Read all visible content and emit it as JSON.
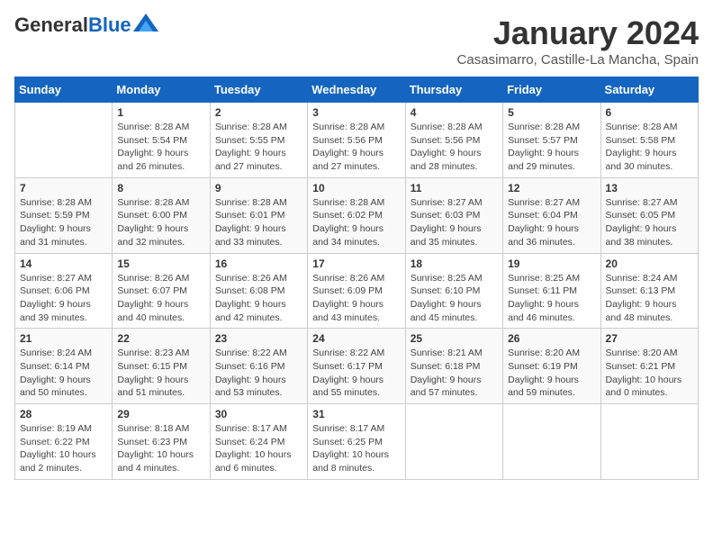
{
  "header": {
    "logo_general": "General",
    "logo_blue": "Blue",
    "month_title": "January 2024",
    "subtitle": "Casasimarro, Castille-La Mancha, Spain"
  },
  "days_of_week": [
    "Sunday",
    "Monday",
    "Tuesday",
    "Wednesday",
    "Thursday",
    "Friday",
    "Saturday"
  ],
  "weeks": [
    [
      {
        "day": "",
        "content": ""
      },
      {
        "day": "1",
        "content": "Sunrise: 8:28 AM\nSunset: 5:54 PM\nDaylight: 9 hours\nand 26 minutes."
      },
      {
        "day": "2",
        "content": "Sunrise: 8:28 AM\nSunset: 5:55 PM\nDaylight: 9 hours\nand 27 minutes."
      },
      {
        "day": "3",
        "content": "Sunrise: 8:28 AM\nSunset: 5:56 PM\nDaylight: 9 hours\nand 27 minutes."
      },
      {
        "day": "4",
        "content": "Sunrise: 8:28 AM\nSunset: 5:56 PM\nDaylight: 9 hours\nand 28 minutes."
      },
      {
        "day": "5",
        "content": "Sunrise: 8:28 AM\nSunset: 5:57 PM\nDaylight: 9 hours\nand 29 minutes."
      },
      {
        "day": "6",
        "content": "Sunrise: 8:28 AM\nSunset: 5:58 PM\nDaylight: 9 hours\nand 30 minutes."
      }
    ],
    [
      {
        "day": "7",
        "content": "Sunrise: 8:28 AM\nSunset: 5:59 PM\nDaylight: 9 hours\nand 31 minutes."
      },
      {
        "day": "8",
        "content": "Sunrise: 8:28 AM\nSunset: 6:00 PM\nDaylight: 9 hours\nand 32 minutes."
      },
      {
        "day": "9",
        "content": "Sunrise: 8:28 AM\nSunset: 6:01 PM\nDaylight: 9 hours\nand 33 minutes."
      },
      {
        "day": "10",
        "content": "Sunrise: 8:28 AM\nSunset: 6:02 PM\nDaylight: 9 hours\nand 34 minutes."
      },
      {
        "day": "11",
        "content": "Sunrise: 8:27 AM\nSunset: 6:03 PM\nDaylight: 9 hours\nand 35 minutes."
      },
      {
        "day": "12",
        "content": "Sunrise: 8:27 AM\nSunset: 6:04 PM\nDaylight: 9 hours\nand 36 minutes."
      },
      {
        "day": "13",
        "content": "Sunrise: 8:27 AM\nSunset: 6:05 PM\nDaylight: 9 hours\nand 38 minutes."
      }
    ],
    [
      {
        "day": "14",
        "content": "Sunrise: 8:27 AM\nSunset: 6:06 PM\nDaylight: 9 hours\nand 39 minutes."
      },
      {
        "day": "15",
        "content": "Sunrise: 8:26 AM\nSunset: 6:07 PM\nDaylight: 9 hours\nand 40 minutes."
      },
      {
        "day": "16",
        "content": "Sunrise: 8:26 AM\nSunset: 6:08 PM\nDaylight: 9 hours\nand 42 minutes."
      },
      {
        "day": "17",
        "content": "Sunrise: 8:26 AM\nSunset: 6:09 PM\nDaylight: 9 hours\nand 43 minutes."
      },
      {
        "day": "18",
        "content": "Sunrise: 8:25 AM\nSunset: 6:10 PM\nDaylight: 9 hours\nand 45 minutes."
      },
      {
        "day": "19",
        "content": "Sunrise: 8:25 AM\nSunset: 6:11 PM\nDaylight: 9 hours\nand 46 minutes."
      },
      {
        "day": "20",
        "content": "Sunrise: 8:24 AM\nSunset: 6:13 PM\nDaylight: 9 hours\nand 48 minutes."
      }
    ],
    [
      {
        "day": "21",
        "content": "Sunrise: 8:24 AM\nSunset: 6:14 PM\nDaylight: 9 hours\nand 50 minutes."
      },
      {
        "day": "22",
        "content": "Sunrise: 8:23 AM\nSunset: 6:15 PM\nDaylight: 9 hours\nand 51 minutes."
      },
      {
        "day": "23",
        "content": "Sunrise: 8:22 AM\nSunset: 6:16 PM\nDaylight: 9 hours\nand 53 minutes."
      },
      {
        "day": "24",
        "content": "Sunrise: 8:22 AM\nSunset: 6:17 PM\nDaylight: 9 hours\nand 55 minutes."
      },
      {
        "day": "25",
        "content": "Sunrise: 8:21 AM\nSunset: 6:18 PM\nDaylight: 9 hours\nand 57 minutes."
      },
      {
        "day": "26",
        "content": "Sunrise: 8:20 AM\nSunset: 6:19 PM\nDaylight: 9 hours\nand 59 minutes."
      },
      {
        "day": "27",
        "content": "Sunrise: 8:20 AM\nSunset: 6:21 PM\nDaylight: 10 hours\nand 0 minutes."
      }
    ],
    [
      {
        "day": "28",
        "content": "Sunrise: 8:19 AM\nSunset: 6:22 PM\nDaylight: 10 hours\nand 2 minutes."
      },
      {
        "day": "29",
        "content": "Sunrise: 8:18 AM\nSunset: 6:23 PM\nDaylight: 10 hours\nand 4 minutes."
      },
      {
        "day": "30",
        "content": "Sunrise: 8:17 AM\nSunset: 6:24 PM\nDaylight: 10 hours\nand 6 minutes."
      },
      {
        "day": "31",
        "content": "Sunrise: 8:17 AM\nSunset: 6:25 PM\nDaylight: 10 hours\nand 8 minutes."
      },
      {
        "day": "",
        "content": ""
      },
      {
        "day": "",
        "content": ""
      },
      {
        "day": "",
        "content": ""
      }
    ]
  ]
}
